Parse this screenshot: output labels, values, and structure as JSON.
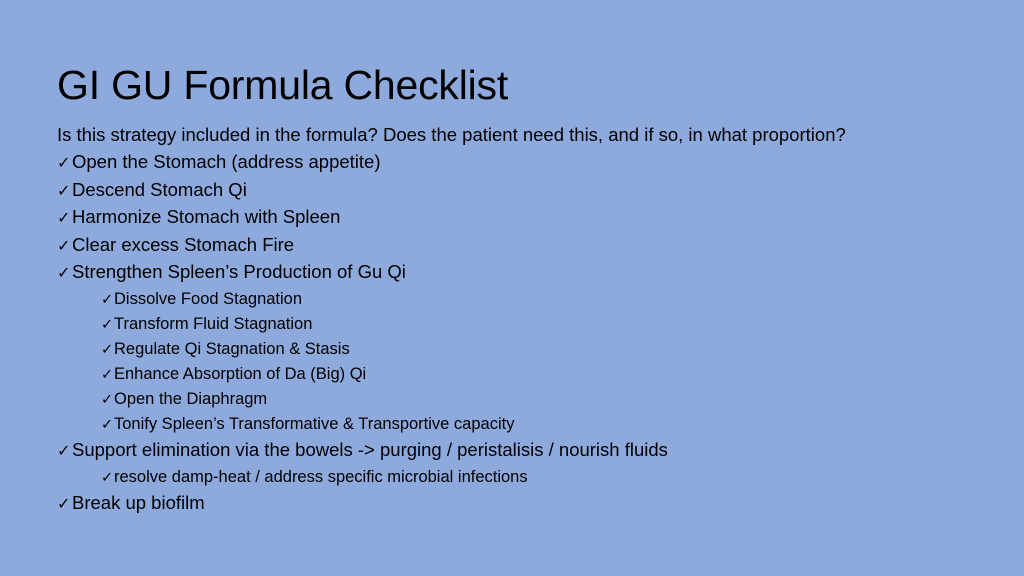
{
  "slide": {
    "title": "GI GU Formula Checklist",
    "intro": "Is this strategy included in the formula?  Does the patient need this, and if so, in what proportion?",
    "check_glyph": "✓",
    "background_color": "#8ea9dc",
    "text_color": "#000000",
    "items": [
      {
        "level": 1,
        "text": "Open the Stomach (address appetite)"
      },
      {
        "level": 1,
        "text": "Descend Stomach Qi"
      },
      {
        "level": 1,
        "text": "Harmonize Stomach with Spleen"
      },
      {
        "level": 1,
        "text": "Clear excess Stomach Fire"
      },
      {
        "level": 1,
        "text": "Strengthen Spleen’s Production of Gu Qi"
      },
      {
        "level": 2,
        "text": "Dissolve Food Stagnation"
      },
      {
        "level": 2,
        "text": "Transform Fluid Stagnation"
      },
      {
        "level": 2,
        "text": "Regulate Qi Stagnation & Stasis"
      },
      {
        "level": 2,
        "text": "Enhance Absorption of Da (Big) Qi"
      },
      {
        "level": 2,
        "text": "Open the Diaphragm"
      },
      {
        "level": 2,
        "text": "Tonify Spleen’s Transformative & Transportive capacity"
      },
      {
        "level": 1,
        "text": "Support elimination via the bowels  -> purging / peristalisis / nourish fluids"
      },
      {
        "level": 2,
        "text": "resolve damp-heat  / address specific microbial infections"
      },
      {
        "level": 1,
        "text": "Break up biofilm"
      }
    ]
  }
}
